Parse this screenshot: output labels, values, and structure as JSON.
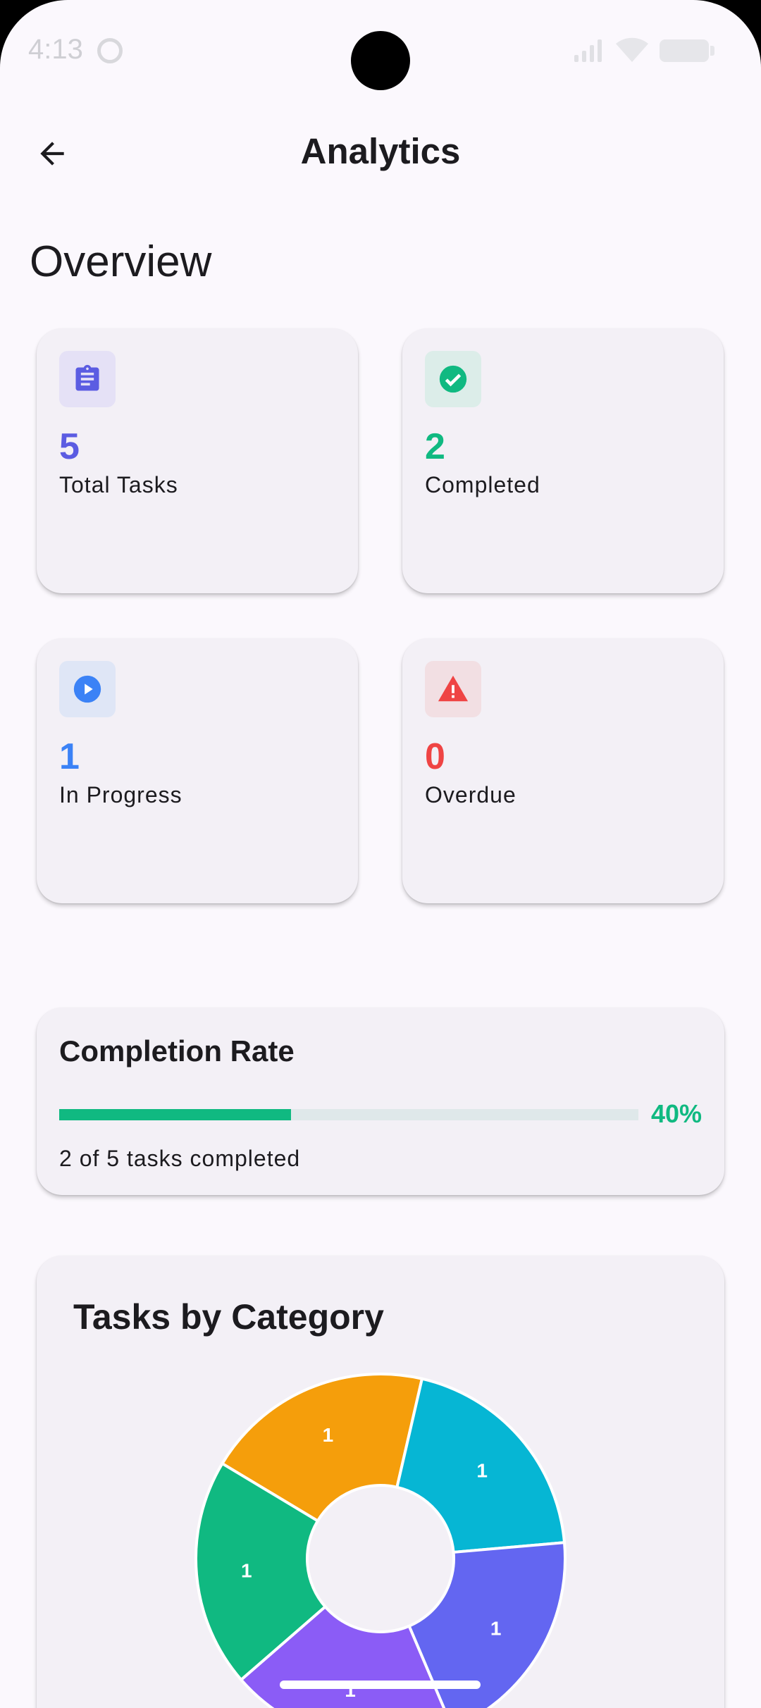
{
  "status_bar": {
    "time": "4:13"
  },
  "app_bar": {
    "title": "Analytics"
  },
  "section_title": "Overview",
  "stats": [
    {
      "value": "5",
      "label": "Total Tasks",
      "icon": "clipboard-icon",
      "color": "#5b5ce2",
      "icon_bg": "#e5e1f6"
    },
    {
      "value": "2",
      "label": "Completed",
      "icon": "check-circle-icon",
      "color": "#10b981",
      "icon_bg": "#dcede9"
    },
    {
      "value": "1",
      "label": "In Progress",
      "icon": "play-circle-icon",
      "color": "#3b82f6",
      "icon_bg": "#dfe6f6"
    },
    {
      "value": "0",
      "label": "Overdue",
      "icon": "warning-icon",
      "color": "#ef4444",
      "icon_bg": "#f2dfe3"
    }
  ],
  "completion": {
    "title": "Completion Rate",
    "percent_label": "40%",
    "fraction": 0.4,
    "summary": "2 of 5 tasks completed"
  },
  "category_card": {
    "title": "Tasks by Category"
  },
  "chart_data": {
    "type": "pie",
    "style": "donut",
    "slices": [
      {
        "value": 1,
        "label": "1",
        "color": "#f59e0b"
      },
      {
        "value": 1,
        "label": "1",
        "color": "#06b6d4"
      },
      {
        "value": 1,
        "label": "1",
        "color": "#6366f1"
      },
      {
        "value": 1,
        "label": "1",
        "color": "#8b5cf6"
      },
      {
        "value": 1,
        "label": "1",
        "color": "#10b981"
      }
    ]
  }
}
